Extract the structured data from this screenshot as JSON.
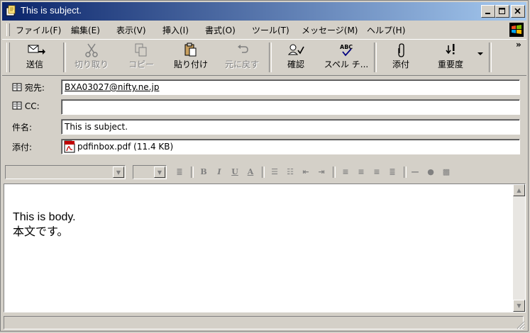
{
  "window": {
    "title": "This is subject."
  },
  "menu": [
    "ファイル(F)",
    "編集(E)",
    "表示(V)",
    "挿入(I)",
    "書式(O)",
    "ツール(T)",
    "メッセージ(M)",
    "ヘルプ(H)"
  ],
  "toolbar": {
    "send": "送信",
    "cut": "切り取り",
    "copy": "コピー",
    "paste": "貼り付け",
    "undo": "元に戻す",
    "check": "確認",
    "spell": "スペル チ...",
    "attach": "添付",
    "priority": "重要度",
    "overflow": "»"
  },
  "fields": {
    "to_label": "宛先:",
    "to_value": "BXA03027@nifty.ne.jp",
    "cc_label": "CC:",
    "cc_value": "",
    "subject_label": "件名:",
    "subject_value": "This is subject.",
    "attach_label": "添付:",
    "attach_value": "pdfinbox.pdf (11.4 KB)"
  },
  "body": {
    "line1": "This is body.",
    "line2": "本文です。"
  },
  "colors": {
    "titlebar_start": "#0a246a",
    "titlebar_end": "#a6caf0",
    "link": "#000080"
  }
}
